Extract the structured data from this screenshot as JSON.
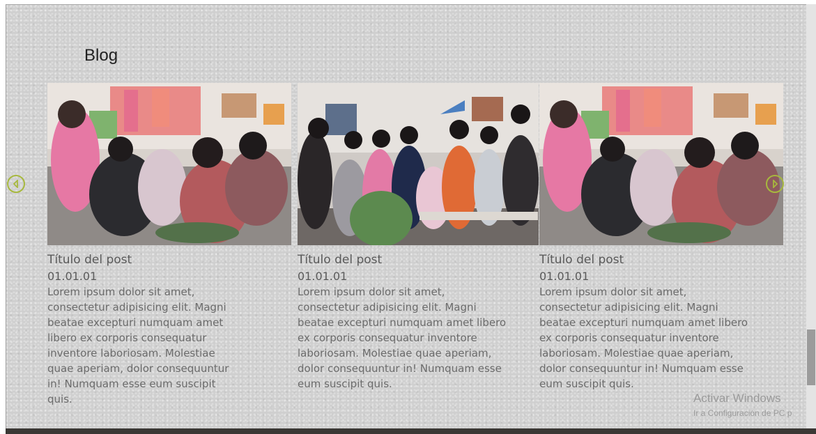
{
  "section": {
    "title": "Blog"
  },
  "carousel": {
    "prev_icon": "chevron-left-circle-icon",
    "next_icon": "chevron-right-circle-icon",
    "accent_color": "#a7b83e",
    "posts": [
      {
        "title": "Título del post",
        "date": "01.01.01",
        "excerpt": "Lorem ipsum dolor sit amet, consectetur adipisicing elit. Magni beatae excepturi numquam amet libero ex corporis consequatur inventore laboriosam. Molestiae quae aperiam, dolor consequuntur in! Numquam esse eum suscipit quis."
      },
      {
        "title": "Título del post",
        "date": "01.01.01",
        "excerpt": "Lorem ipsum dolor sit amet, consectetur adipisicing elit. Magni beatae excepturi numquam amet libero ex corporis consequatur inventore laboriosam. Molestiae quae aperiam, dolor consequuntur in! Numquam esse eum suscipit quis."
      },
      {
        "title": "Título del post",
        "date": "01.01.01",
        "excerpt": "Lorem ipsum dolor sit amet, consectetur adipisicing elit. Magni beatae excepturi numquam amet libero ex corporis consequatur inventore laboriosam. Molestiae quae aperiam, dolor consequuntur in! Numquam esse eum suscipit quis."
      }
    ]
  },
  "watermark": {
    "title": "Activar Windows",
    "subtitle": "Ir a Configuración de PC p"
  }
}
